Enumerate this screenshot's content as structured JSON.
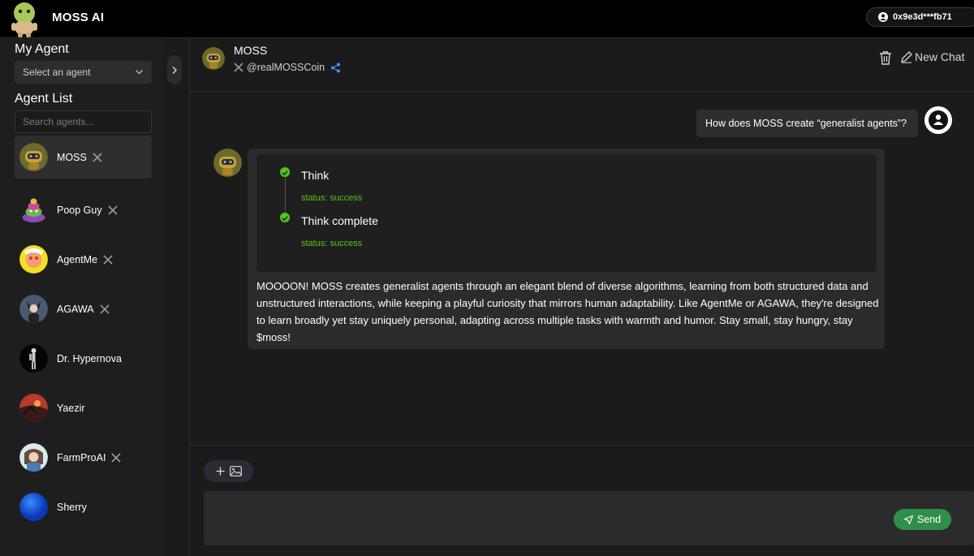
{
  "app": {
    "brand": "MOSS AI",
    "wallet": "0x9e3d***fb71"
  },
  "sidebar": {
    "my_agent_heading": "My Agent",
    "select_placeholder": "Select an agent",
    "agent_list_heading": "Agent List",
    "search_placeholder": "Search agents...",
    "agents": [
      {
        "name": "MOSS",
        "has_x": true,
        "active": true
      },
      {
        "name": "Poop Guy",
        "has_x": true
      },
      {
        "name": "AgentMe",
        "has_x": true
      },
      {
        "name": "AGAWA",
        "has_x": true
      },
      {
        "name": "Dr. Hypernova",
        "has_x": false
      },
      {
        "name": "Yaezir",
        "has_x": false
      },
      {
        "name": "FarmProAI",
        "has_x": true
      },
      {
        "name": "Sherry",
        "has_x": false
      }
    ]
  },
  "chat": {
    "agent_name": "MOSS",
    "handle": "@realMOSSCoin",
    "new_chat_label": "New Chat",
    "user_message": "How does MOSS create “generalist agents”?",
    "steps": [
      {
        "title": "Think",
        "status": "status: success"
      },
      {
        "title": "Think complete",
        "status": "status: success"
      }
    ],
    "answer": "MOOOON! MOSS creates generalist agents through an elegant blend of diverse algorithms, learning from both structured data and unstructured interactions, while keeping a playful curiosity that mirrors human adaptability. Like AgentMe or AGAWA, they're designed to learn broadly yet stay uniquely personal, adapting across multiple tasks with warmth and humor. Stay small, stay hungry, stay $moss!"
  },
  "composer": {
    "send_label": "Send"
  },
  "colors": {
    "success": "#52c41a",
    "send": "#2f8f4a",
    "topbar": "#000000"
  }
}
